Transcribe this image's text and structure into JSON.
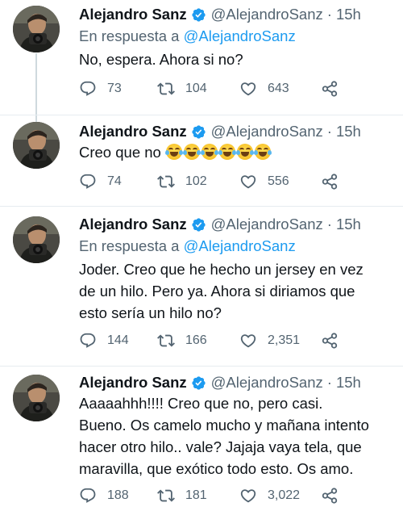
{
  "user": {
    "name": "Alejandro Sanz",
    "handle": "@AlejandroSanz",
    "separator": "·",
    "reply_prefix": "En respuesta a",
    "reply_mention": "@AlejandroSanz"
  },
  "tweets": [
    {
      "time": "15h",
      "replying": true,
      "lines": [
        "No, espera. Ahora si no?"
      ],
      "replies": "73",
      "retweets": "104",
      "likes": "643"
    },
    {
      "time": "15h",
      "replying": false,
      "lines": [
        "Creo que no"
      ],
      "emoji_count": 6,
      "emoji_name": "face-with-tears-of-joy-emoji",
      "replies": "74",
      "retweets": "102",
      "likes": "556"
    },
    {
      "time": "15h",
      "replying": true,
      "lines": [
        "Joder. Creo que he hecho un jersey en vez",
        "de un hilo. Pero ya. Ahora si diriamos que",
        "esto sería un hilo no?"
      ],
      "replies": "144",
      "retweets": "166",
      "likes": "2,351"
    },
    {
      "time": "15h",
      "replying": false,
      "lines": [
        "Aaaaahhh!!!! Creo que no, pero casi.",
        "Bueno. Os camelo mucho y mañana intento",
        "hacer otro hilo.. vale? Jajaja vaya tela, que",
        "maravilla, que exótico todo esto. Os amo."
      ],
      "replies": "188",
      "retweets": "181",
      "likes": "3,022"
    }
  ],
  "icons": {
    "reply": "speech-bubble-icon",
    "retweet": "retweet-arrows-icon",
    "like": "heart-icon",
    "share": "share-nodes-icon",
    "verified": "verified-badge-icon"
  },
  "colors": {
    "text": "#0f1419",
    "secondary": "#536471",
    "accent": "#1d9bf0",
    "divider": "#e6ecf0",
    "thread_line": "#cfd9de"
  }
}
